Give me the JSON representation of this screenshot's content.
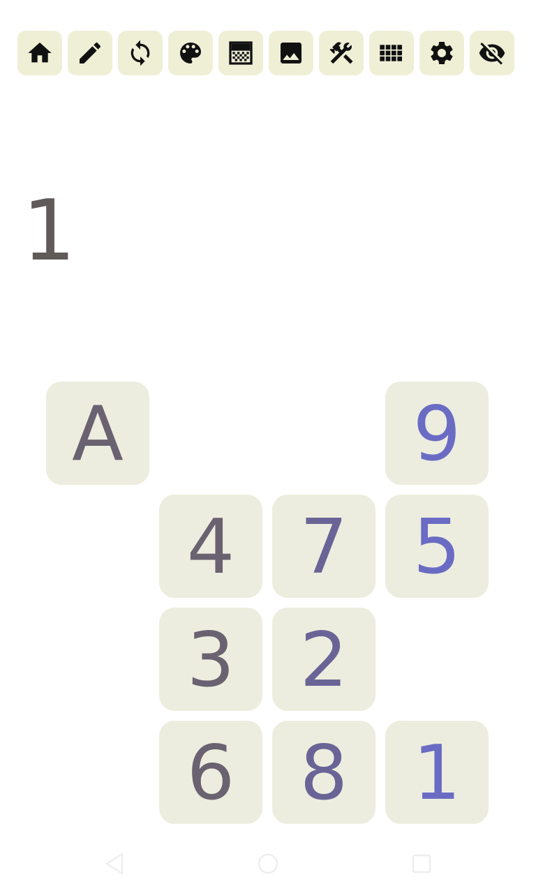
{
  "toolbar": {
    "items": [
      {
        "name": "home",
        "icon": "home-icon"
      },
      {
        "name": "edit",
        "icon": "pencil-icon"
      },
      {
        "name": "refresh",
        "icon": "refresh-icon"
      },
      {
        "name": "palette",
        "icon": "palette-icon"
      },
      {
        "name": "gradient",
        "icon": "gradient-icon"
      },
      {
        "name": "image",
        "icon": "image-icon"
      },
      {
        "name": "tools",
        "icon": "tools-icon"
      },
      {
        "name": "grid",
        "icon": "grid-icon"
      },
      {
        "name": "settings",
        "icon": "gear-icon"
      },
      {
        "name": "visibility",
        "icon": "eye-off-icon"
      }
    ],
    "button_color": "#efefd6"
  },
  "display": {
    "value": "1"
  },
  "tiles": {
    "a": "A",
    "nine": "9",
    "four": "4",
    "seven": "7",
    "five": "5",
    "three": "3",
    "two": "2",
    "six": "6",
    "eight": "8",
    "one": "1"
  },
  "colors": {
    "tile_bg": "#ededdf",
    "text_grey": "#6a6270",
    "text_mid": "#6a6496",
    "text_blue": "#6a6cc4"
  },
  "navbar": {
    "items": [
      "back-icon",
      "home-circle-icon",
      "recents-icon"
    ]
  }
}
